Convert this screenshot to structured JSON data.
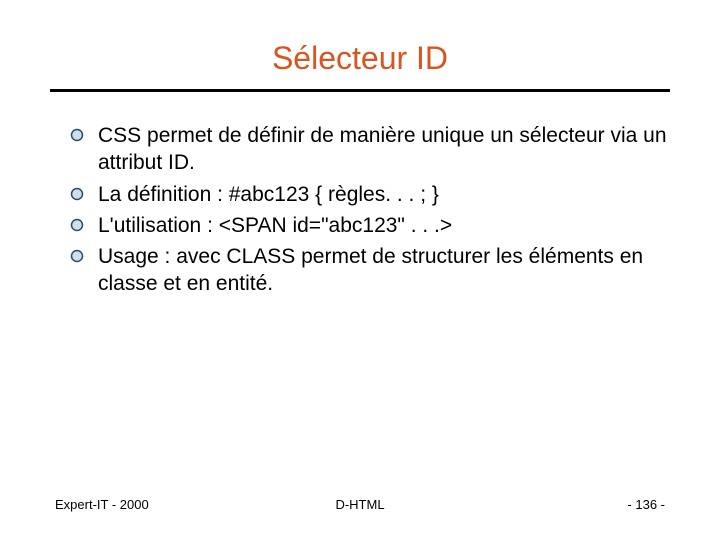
{
  "title": "Sélecteur ID",
  "bullets": [
    "CSS permet de définir de manière unique un sélecteur via un attribut ID.",
    "La définition : #abc123 { règles. . . ; }",
    "L'utilisation : <SPAN id=\"abc123\" . . .>",
    "Usage : avec CLASS permet de structurer les éléments en classe et en entité."
  ],
  "footer": {
    "left": "Expert-IT - 2000",
    "center": "D-HTML",
    "right": "- 136 -"
  },
  "colors": {
    "accent": "#d9541e",
    "bullet_fill": "#cfe0ec",
    "bullet_stroke": "#2a4a6a"
  }
}
